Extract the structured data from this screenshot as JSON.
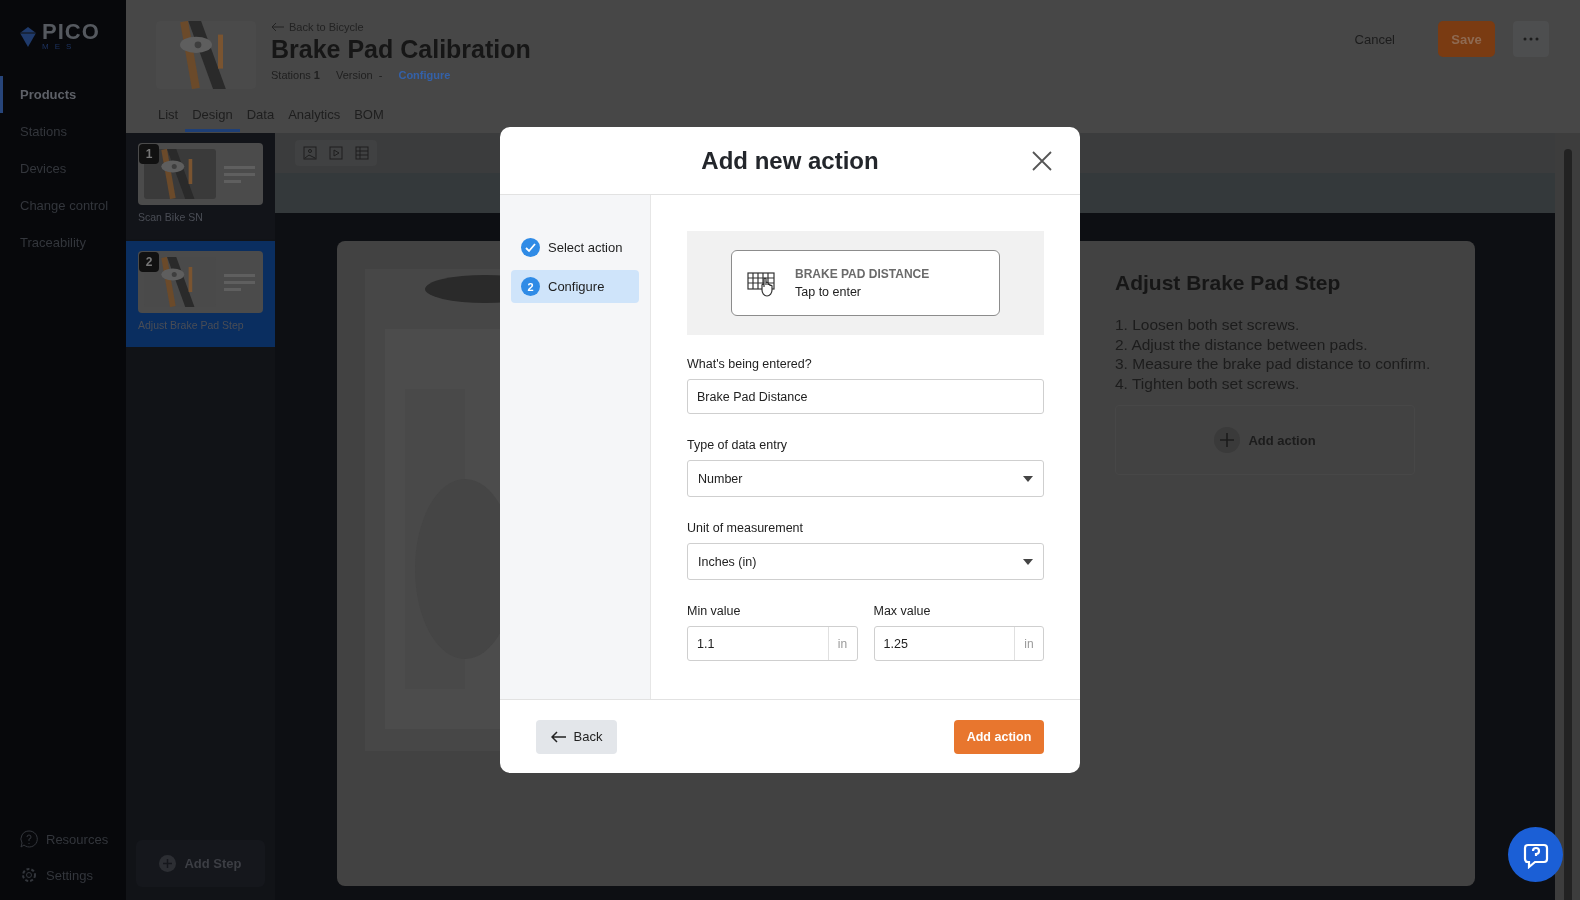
{
  "sidebar": {
    "logo": {
      "name": "PICO",
      "tag": "MES"
    },
    "nav": [
      {
        "label": "Products",
        "selected": true
      },
      {
        "label": "Stations",
        "selected": false
      },
      {
        "label": "Devices",
        "selected": false
      },
      {
        "label": "Change control",
        "selected": false
      },
      {
        "label": "Traceability",
        "selected": false
      }
    ],
    "footer": [
      {
        "label": "Resources",
        "kind": "help"
      },
      {
        "label": "Settings",
        "kind": "gear"
      }
    ]
  },
  "header": {
    "back_link": "Back to Bicycle",
    "title": "Brake Pad Calibration",
    "stations_label": "Stations",
    "stations_value": "1",
    "version_label": "Version",
    "version_value": "-",
    "configure_link": "Configure",
    "cancel": "Cancel",
    "save": "Save"
  },
  "tabs": [
    {
      "label": "List",
      "selected": false
    },
    {
      "label": "Design",
      "selected": true
    },
    {
      "label": "Data",
      "selected": false
    },
    {
      "label": "Analytics",
      "selected": false
    },
    {
      "label": "BOM",
      "selected": false
    }
  ],
  "steps": [
    {
      "number": "1",
      "label": "Scan Bike SN",
      "selected": false
    },
    {
      "number": "2",
      "label": "Adjust Brake Pad Step",
      "selected": true
    }
  ],
  "add_step": "Add Step",
  "step_detail": {
    "title": "Adjust Brake Pad Step",
    "instructions": [
      "1. Loosen both set screws.",
      "2. Adjust the distance between pads.",
      "3. Measure the brake pad distance to confirm.",
      "4. Tighten both set screws."
    ],
    "add_action": "Add action"
  },
  "modal": {
    "title": "Add new action",
    "stepper": [
      {
        "label": "Select action",
        "done": true,
        "selected": false
      },
      {
        "label": "Configure",
        "number": "2",
        "done": false,
        "selected": true
      }
    ],
    "preview": {
      "title": "BRAKE PAD DISTANCE",
      "subtitle": "Tap to enter"
    },
    "fields": [
      {
        "kind": "text",
        "label": "What's being entered?",
        "value": "Brake Pad Distance"
      },
      {
        "kind": "select",
        "label": "Type of data entry",
        "value": "Number"
      },
      {
        "kind": "select",
        "label": "Unit of measurement",
        "value": "Inches (in)"
      }
    ],
    "range": [
      {
        "label": "Min value",
        "value": "1.1",
        "unit": "in"
      },
      {
        "label": "Max value",
        "value": "1.25",
        "unit": "in"
      }
    ],
    "back": "Back",
    "submit": "Add action"
  }
}
